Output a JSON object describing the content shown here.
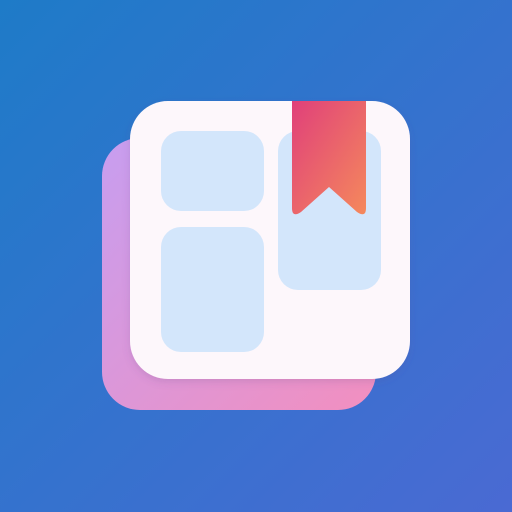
{
  "icon": {
    "name": "bookmark-widgets-app-icon",
    "colors": {
      "background_start": "#1e7bc8",
      "background_end": "#4a6ad3",
      "shadow_card_start": "#c79ef0",
      "shadow_card_end": "#f28fbf",
      "card": "#fdf7fb",
      "tile": "#d3e6fb",
      "bookmark_start": "#e0407a",
      "bookmark_end": "#f5895c"
    }
  }
}
